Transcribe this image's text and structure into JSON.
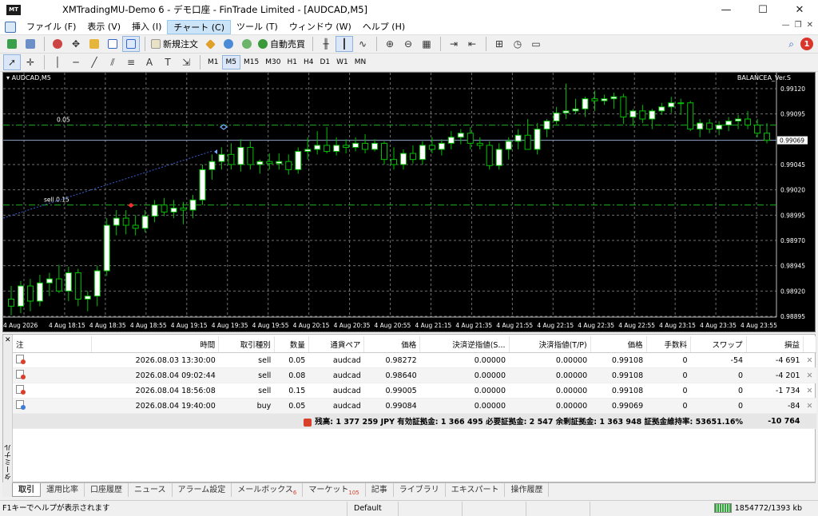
{
  "window": {
    "title": "XMTradingMU-Demo 6 - デモ口座 - FinTrade Limited - [AUDCAD,M5]",
    "app_icon": "MT",
    "min": "—",
    "max": "☐",
    "close": "✕"
  },
  "menu": [
    "ファイル (F)",
    "表示 (V)",
    "挿入 (I)",
    "チャート (C)",
    "ツール (T)",
    "ウィンドウ (W)",
    "ヘルプ (H)"
  ],
  "toolbar": {
    "new_order": "新規注文",
    "auto_trade": "自動売買",
    "notification_count": "1"
  },
  "timeframes": [
    "M1",
    "M5",
    "M15",
    "M30",
    "H1",
    "H4",
    "D1",
    "W1",
    "MN"
  ],
  "chart": {
    "title": "AUDCAD,M5",
    "indicator": "BALANCEA_Ver.S",
    "current_price_label": "0.99069",
    "order_line_labels": [
      "0.05",
      "sell 0.15"
    ],
    "colors": {
      "bg": "#000000",
      "bull": "#ffffff",
      "bear": "#000000",
      "wick": "#00c000",
      "order_line": "#1fae1f",
      "grid": "#6e6e6e"
    }
  },
  "chart_data": {
    "type": "candlestick",
    "symbol": "AUDCAD",
    "timeframe": "M5",
    "ylim": [
      0.98895,
      0.9912
    ],
    "y_ticks": [
      "0.99120",
      "0.99095",
      "0.99069",
      "0.99045",
      "0.99020",
      "0.98995",
      "0.98970",
      "0.98945",
      "0.98920",
      "0.98895"
    ],
    "x_ticks": [
      "4 Aug 2026",
      "4 Aug 18:15",
      "4 Aug 18:35",
      "4 Aug 18:55",
      "4 Aug 19:15",
      "4 Aug 19:35",
      "4 Aug 19:55",
      "4 Aug 20:15",
      "4 Aug 20:35",
      "4 Aug 20:55",
      "4 Aug 21:15",
      "4 Aug 21:35",
      "4 Aug 21:55",
      "4 Aug 22:15",
      "4 Aug 22:35",
      "4 Aug 22:55",
      "4 Aug 23:15",
      "4 Aug 23:35",
      "4 Aug 23:55"
    ],
    "order_lines": [
      {
        "label": "0.05",
        "price": 0.99084
      },
      {
        "label": "sell 0.15",
        "price": 0.99005
      }
    ],
    "current_price": 0.99069,
    "candles": [
      [
        0.98912,
        0.98925,
        0.98896,
        0.98905
      ],
      [
        0.98905,
        0.9893,
        0.98898,
        0.98925
      ],
      [
        0.98925,
        0.98932,
        0.989,
        0.9891
      ],
      [
        0.9891,
        0.98936,
        0.98905,
        0.98928
      ],
      [
        0.98928,
        0.98938,
        0.98915,
        0.98932
      ],
      [
        0.98932,
        0.98946,
        0.98918,
        0.9892
      ],
      [
        0.9892,
        0.98944,
        0.9891,
        0.98938
      ],
      [
        0.98938,
        0.98942,
        0.98905,
        0.98912
      ],
      [
        0.98912,
        0.9892,
        0.989,
        0.98915
      ],
      [
        0.98915,
        0.98945,
        0.98905,
        0.9894
      ],
      [
        0.9894,
        0.98992,
        0.98935,
        0.98985
      ],
      [
        0.98985,
        0.99,
        0.98975,
        0.98992
      ],
      [
        0.98992,
        0.99,
        0.98976,
        0.98985
      ],
      [
        0.98985,
        0.98995,
        0.98975,
        0.98982
      ],
      [
        0.98982,
        0.99,
        0.98978,
        0.98994
      ],
      [
        0.98994,
        0.9901,
        0.98988,
        0.99005
      ],
      [
        0.99005,
        0.99012,
        0.98994,
        0.98998
      ],
      [
        0.98998,
        0.9901,
        0.98992,
        0.99002
      ],
      [
        0.99002,
        0.99008,
        0.98986,
        0.99
      ],
      [
        0.99,
        0.99015,
        0.98992,
        0.9901
      ],
      [
        0.9901,
        0.99045,
        0.99005,
        0.9904
      ],
      [
        0.9904,
        0.99055,
        0.9903,
        0.99048
      ],
      [
        0.99048,
        0.99062,
        0.9904,
        0.99055
      ],
      [
        0.99055,
        0.99066,
        0.9904,
        0.99045
      ],
      [
        0.99045,
        0.9907,
        0.99038,
        0.99062
      ],
      [
        0.99062,
        0.99068,
        0.9904,
        0.99045
      ],
      [
        0.99045,
        0.9905,
        0.99036,
        0.99048
      ],
      [
        0.99048,
        0.99056,
        0.9904,
        0.99046
      ],
      [
        0.99046,
        0.99056,
        0.9904,
        0.99048
      ],
      [
        0.99048,
        0.99055,
        0.99035,
        0.9904
      ],
      [
        0.9904,
        0.99062,
        0.99036,
        0.99058
      ],
      [
        0.99058,
        0.99072,
        0.9905,
        0.9906
      ],
      [
        0.9906,
        0.99078,
        0.99055,
        0.99064
      ],
      [
        0.99064,
        0.99082,
        0.99056,
        0.99058
      ],
      [
        0.99058,
        0.99072,
        0.99054,
        0.99064
      ],
      [
        0.99064,
        0.9907,
        0.99056,
        0.99062
      ],
      [
        0.99062,
        0.99072,
        0.99058,
        0.99066
      ],
      [
        0.99066,
        0.99075,
        0.99056,
        0.9906
      ],
      [
        0.9906,
        0.9907,
        0.99058,
        0.99066
      ],
      [
        0.99066,
        0.99068,
        0.99045,
        0.9905
      ],
      [
        0.9905,
        0.99062,
        0.9904,
        0.99045
      ],
      [
        0.99045,
        0.9906,
        0.9904,
        0.99056
      ],
      [
        0.99056,
        0.99064,
        0.99046,
        0.9905
      ],
      [
        0.9905,
        0.99068,
        0.99045,
        0.99064
      ],
      [
        0.99064,
        0.99072,
        0.99056,
        0.9906
      ],
      [
        0.9906,
        0.9907,
        0.99054,
        0.99066
      ],
      [
        0.99066,
        0.99078,
        0.9906,
        0.99072
      ],
      [
        0.99072,
        0.9908,
        0.99065,
        0.99076
      ],
      [
        0.99076,
        0.99082,
        0.9906,
        0.99066
      ],
      [
        0.99066,
        0.99072,
        0.9906,
        0.99064
      ],
      [
        0.99064,
        0.99068,
        0.9904,
        0.99044
      ],
      [
        0.99044,
        0.99066,
        0.9904,
        0.9906
      ],
      [
        0.9906,
        0.99072,
        0.9905,
        0.99068
      ],
      [
        0.99068,
        0.9908,
        0.9906,
        0.99074
      ],
      [
        0.99074,
        0.9909,
        0.99064,
        0.9906
      ],
      [
        0.9906,
        0.99086,
        0.99055,
        0.9908
      ],
      [
        0.9908,
        0.9909,
        0.99072,
        0.99088
      ],
      [
        0.99088,
        0.99102,
        0.99085,
        0.99096
      ],
      [
        0.99096,
        0.99125,
        0.9909,
        0.99098
      ],
      [
        0.99098,
        0.9911,
        0.99095,
        0.991
      ],
      [
        0.991,
        0.99112,
        0.99092,
        0.9911
      ],
      [
        0.9911,
        0.99118,
        0.99098,
        0.99108
      ],
      [
        0.99108,
        0.99114,
        0.99104,
        0.9911
      ],
      [
        0.9911,
        0.99116,
        0.991,
        0.99112
      ],
      [
        0.99112,
        0.99115,
        0.99085,
        0.99092
      ],
      [
        0.99092,
        0.991,
        0.99084,
        0.99098
      ],
      [
        0.99098,
        0.99104,
        0.99086,
        0.9909
      ],
      [
        0.9909,
        0.991,
        0.9908,
        0.99098
      ],
      [
        0.99098,
        0.99106,
        0.99094,
        0.99102
      ],
      [
        0.99102,
        0.99112,
        0.99096,
        0.99106
      ],
      [
        0.99106,
        0.9911,
        0.99094,
        0.99106
      ],
      [
        0.99106,
        0.99108,
        0.99078,
        0.9908
      ],
      [
        0.9908,
        0.9909,
        0.99072,
        0.99086
      ],
      [
        0.99086,
        0.9909,
        0.99076,
        0.9908
      ],
      [
        0.9908,
        0.99088,
        0.99074,
        0.99084
      ],
      [
        0.99084,
        0.99092,
        0.99078,
        0.99088
      ],
      [
        0.99088,
        0.99094,
        0.9908,
        0.9909
      ],
      [
        0.9909,
        0.99098,
        0.9908,
        0.99084
      ],
      [
        0.99084,
        0.9909,
        0.99072,
        0.99076
      ],
      [
        0.99076,
        0.99086,
        0.99066,
        0.99069
      ]
    ]
  },
  "terminal": {
    "vertical_label": "ターミナル",
    "close_label": "✕",
    "headers": [
      "注",
      "時間",
      "取引種別",
      "数量",
      "通貨ペア",
      "価格",
      "決済逆指値(S...",
      "決済指値(T/P)",
      "価格",
      "手数料",
      "スワップ",
      "損益"
    ],
    "rows": [
      {
        "time": "2026.08.03 13:30:00",
        "type": "sell",
        "volume": "0.05",
        "symbol": "audcad",
        "open_price": "0.98272",
        "sl": "0.00000",
        "tp": "0.00000",
        "price": "0.99108",
        "commission": "0",
        "swap": "-54",
        "profit": "-4 691",
        "kind": "sell"
      },
      {
        "time": "2026.08.04 09:02:44",
        "type": "sell",
        "volume": "0.08",
        "symbol": "audcad",
        "open_price": "0.98640",
        "sl": "0.00000",
        "tp": "0.00000",
        "price": "0.99108",
        "commission": "0",
        "swap": "0",
        "profit": "-4 201",
        "kind": "sell"
      },
      {
        "time": "2026.08.04 18:56:08",
        "type": "sell",
        "volume": "0.15",
        "symbol": "audcad",
        "open_price": "0.99005",
        "sl": "0.00000",
        "tp": "0.00000",
        "price": "0.99108",
        "commission": "0",
        "swap": "0",
        "profit": "-1 734",
        "kind": "sell"
      },
      {
        "time": "2026.08.04 19:40:00",
        "type": "buy",
        "volume": "0.05",
        "symbol": "audcad",
        "open_price": "0.99084",
        "sl": "0.00000",
        "tp": "0.00000",
        "price": "0.99069",
        "commission": "0",
        "swap": "0",
        "profit": "-84",
        "kind": "buy"
      }
    ],
    "summary": "残高: 1 377 259 JPY  有効証拠金: 1 366 495  必要証拠金: 2 547  余剰証拠金: 1 363 948  証拠金維持率: 53651.16%",
    "total_profit": "-10 764"
  },
  "tabs": [
    {
      "label": "取引",
      "badge": ""
    },
    {
      "label": "運用比率",
      "badge": ""
    },
    {
      "label": "口座履歴",
      "badge": ""
    },
    {
      "label": "ニュース",
      "badge": ""
    },
    {
      "label": "アラーム設定",
      "badge": ""
    },
    {
      "label": "メールボックス",
      "badge": "6"
    },
    {
      "label": "マーケット",
      "badge": "105"
    },
    {
      "label": "記事",
      "badge": ""
    },
    {
      "label": "ライブラリ",
      "badge": ""
    },
    {
      "label": "エキスパート",
      "badge": ""
    },
    {
      "label": "操作履歴",
      "badge": ""
    }
  ],
  "status": {
    "help": "F1キーでヘルプが表示されます",
    "profile": "Default",
    "connection": "1854772/1393 kb"
  }
}
